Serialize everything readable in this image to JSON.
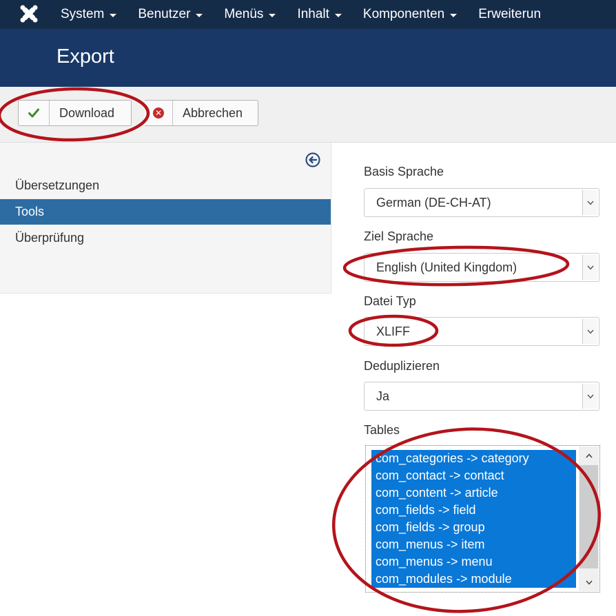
{
  "navbar": {
    "brand_icon": "joomla-logo-icon",
    "items": [
      {
        "label": "System"
      },
      {
        "label": "Benutzer"
      },
      {
        "label": "Menüs"
      },
      {
        "label": "Inhalt"
      },
      {
        "label": "Komponenten"
      },
      {
        "label": "Erweiterun"
      }
    ]
  },
  "header": {
    "title": "Export"
  },
  "toolbar": {
    "download_label": "Download",
    "download_icon": "checkmark-icon",
    "cancel_label": "Abbrechen",
    "cancel_icon": "cancel-circle-icon"
  },
  "sidebar": {
    "toggle_icon": "collapse-left-circle-icon",
    "items": [
      {
        "label": "Übersetzungen",
        "active": false
      },
      {
        "label": "Tools",
        "active": true
      },
      {
        "label": "Überprüfung",
        "active": false
      }
    ]
  },
  "form": {
    "base_language": {
      "label": "Basis Sprache",
      "value": "German (DE-CH-AT)"
    },
    "target_language": {
      "label": "Ziel Sprache",
      "value": "English (United Kingdom)"
    },
    "file_type": {
      "label": "Datei Typ",
      "value": "XLIFF"
    },
    "deduplicate": {
      "label": "Deduplizieren",
      "value": "Ja"
    },
    "tables": {
      "label": "Tables",
      "options": [
        "com_categories -> category",
        "com_contact -> contact",
        "com_content -> article",
        "com_fields -> field",
        "com_fields -> group",
        "com_menus -> item",
        "com_menus -> menu",
        "com_modules -> module"
      ]
    }
  },
  "colors": {
    "navbar": "#152c49",
    "header": "#1a3867",
    "sidebar_active": "#2d6ca2",
    "selection": "#0a78d7",
    "annotation": "#b3141b"
  }
}
